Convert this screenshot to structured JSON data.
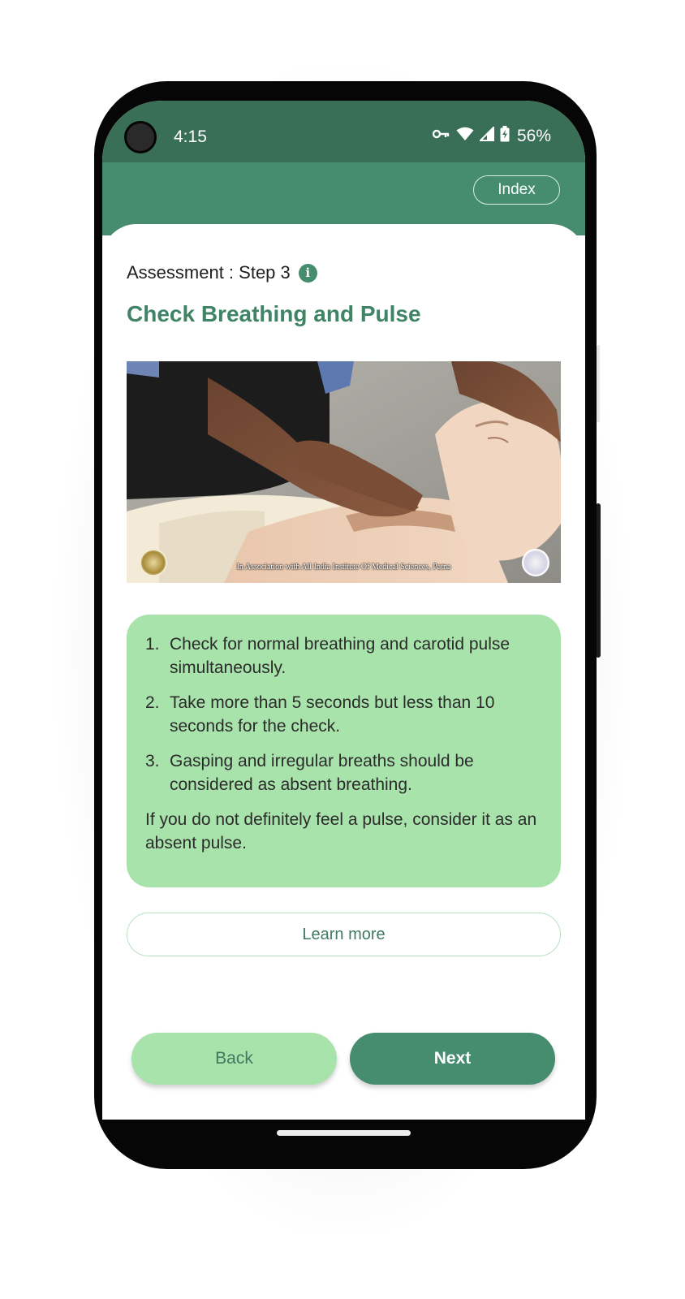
{
  "status_bar": {
    "time": "4:15",
    "battery_percent": "56%",
    "icons": [
      "key-icon",
      "wifi-icon",
      "signal-icon",
      "battery-charging-icon"
    ]
  },
  "header": {
    "index_label": "Index"
  },
  "step": {
    "label": "Assessment : Step 3",
    "info_icon": "info-icon",
    "info_glyph": "i"
  },
  "title": "Check Breathing and Pulse",
  "video": {
    "caption": "In Association with All India Institute Of Medical Sciences, Patna"
  },
  "instructions": {
    "items": [
      {
        "num": "1.",
        "text": "Check for normal breathing and carotid pulse simultaneously."
      },
      {
        "num": "2.",
        "text": "Take more than 5 seconds but less than 10 seconds for the check."
      },
      {
        "num": "3.",
        "text": "Gasping and irregular breaths should be considered as absent breathing."
      }
    ],
    "note": "If you do not definitely feel a pulse, consider it as an absent pulse."
  },
  "learn_more_label": "Learn more",
  "nav": {
    "back_label": "Back",
    "next_label": "Next"
  },
  "colors": {
    "status_bar": "#3a6f57",
    "header": "#468c6e",
    "title": "#3e8465",
    "card": "#a8e3ab",
    "primary_button": "#468c6e"
  }
}
